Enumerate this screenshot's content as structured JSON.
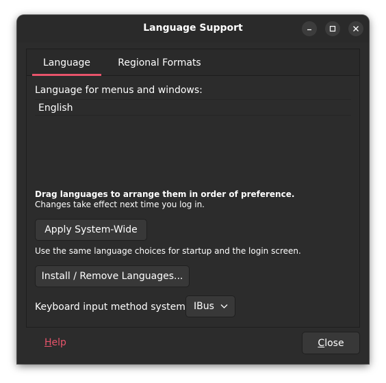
{
  "window": {
    "title": "Language Support"
  },
  "tabs": [
    {
      "label": "Language",
      "active": true
    },
    {
      "label": "Regional Formats",
      "active": false
    }
  ],
  "language_tab": {
    "list_label": "Language for menus and windows:",
    "languages": [
      "English"
    ],
    "hint_bold": "Drag languages to arrange them in order of preference.",
    "hint": "Changes take effect next time you log in.",
    "apply_button": "Apply System-Wide",
    "apply_desc": "Use the same language choices for startup and the login screen.",
    "install_button": "Install / Remove Languages...",
    "keyboard_label": "Keyboard input method system:",
    "keyboard_value": "IBus"
  },
  "footer": {
    "help_first": "H",
    "help_rest": "elp",
    "close_first": "C",
    "close_rest": "lose"
  },
  "colors": {
    "accent": "#e9546b",
    "window_bg": "#2c2c2c",
    "button_bg": "#383838"
  },
  "icons": {
    "minimize": "minimize-icon",
    "maximize": "maximize-icon",
    "close": "close-icon",
    "dropdown": "chevron-down-icon"
  }
}
